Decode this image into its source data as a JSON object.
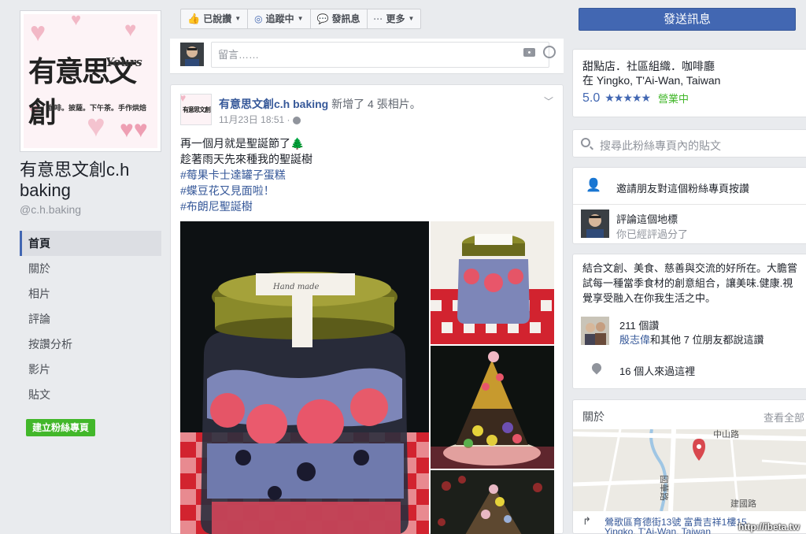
{
  "page": {
    "name": "有意思文創c.h baking",
    "handle": "@c.h.baking",
    "cover": {
      "logo_main": "有意思文創",
      "logo_yours": "Yours",
      "logo_sub": "咖啡。披薩。下午茶。手作烘焙"
    }
  },
  "nav": {
    "items": [
      {
        "label": "首頁",
        "active": true
      },
      {
        "label": "關於"
      },
      {
        "label": "相片"
      },
      {
        "label": "評論"
      },
      {
        "label": "按讚分析"
      },
      {
        "label": "影片"
      },
      {
        "label": "貼文"
      }
    ],
    "create_page": "建立粉絲專頁"
  },
  "actions": {
    "liked": "已說讚",
    "following": "追蹤中",
    "message": "發訊息",
    "more": "更多",
    "send_message": "發送訊息"
  },
  "composer": {
    "placeholder": "留言……"
  },
  "post": {
    "author": "有意思文創c.h baking",
    "action": "新增了 4 張相片。",
    "date": "11月23日 18:51",
    "lines": [
      {
        "text": "再一個月就是聖誕節了🌲",
        "tag": false
      },
      {
        "text": "趁著雨天先來種我的聖誕樹",
        "tag": false
      },
      {
        "text": "#莓果卡士達罐子蛋糕",
        "tag": true
      },
      {
        "text": "#蝶豆花又見面啦！",
        "tag": true
      },
      {
        "text": "#布朗尼聖誕樹",
        "tag": true
      }
    ],
    "jar_label": "Hand made"
  },
  "sidebar": {
    "category": "甜點店．社區組織．咖啡廳",
    "location": "在 Yingko, T'Ai-Wan, Taiwan",
    "rating": "5.0",
    "stars": "★★★★★",
    "open_status": "營業中",
    "search_placeholder": "搜尋此粉絲專頁內的貼文",
    "invite": "邀請朋友對這個粉絲專頁按讚",
    "review_title": "評論這個地標",
    "review_sub": "你已經評過分了",
    "about": "結合文創、美食、慈善與交流的好所在。大膽嘗試每一種當季食材的創意組合，讓美味.健康.視覺享受融入在你我生活之中。",
    "likes_count": "211 個讚",
    "likes_friend": "殷志偉",
    "likes_others": "和其他 7 位朋友都說這讚",
    "checkins": "16 個人來過這裡",
    "about_header": "關於",
    "see_all": "查看全部",
    "map_road1": "中山路",
    "map_road2": "國華路",
    "map_road3": "建國路",
    "address_line1": "鶯歌區育德街13號 富貴吉祥1樓15",
    "address_line2": "Yingko, T'Ai-Wan, Taiwan"
  },
  "watermark": "http://ibeta.tw"
}
